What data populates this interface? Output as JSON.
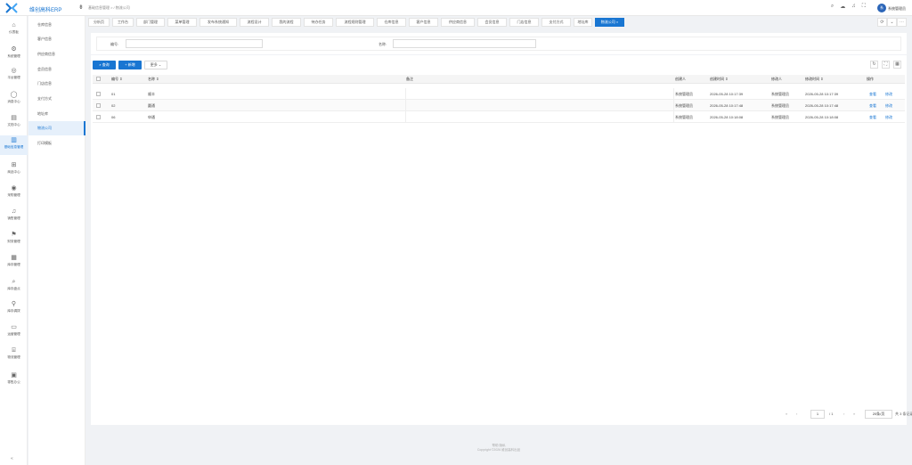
{
  "header": {
    "brand": "维创高科ERP",
    "breadcrumb": "基础信息管理 > / 物流公司",
    "username": "系统管理员",
    "avatar_text": "系",
    "icons": [
      "search-icon",
      "cloud-icon",
      "bell-icon",
      "fullscreen-icon"
    ]
  },
  "sidebar": {
    "items": [
      {
        "label": "仪表板",
        "icon": "home-icon"
      },
      {
        "label": "系统管理",
        "icon": "gear-icon"
      },
      {
        "label": "平台管理",
        "icon": "globe-icon"
      },
      {
        "label": "消息中心",
        "icon": "chat-icon"
      },
      {
        "label": "文档中心",
        "icon": "document-icon"
      },
      {
        "label": "基础信息管理",
        "icon": "book-icon"
      },
      {
        "label": "商品中心",
        "icon": "grid-icon"
      },
      {
        "label": "采购管理",
        "icon": "cart-icon"
      },
      {
        "label": "销售管理",
        "icon": "bell-icon"
      },
      {
        "label": "财务管理",
        "icon": "flag-icon"
      },
      {
        "label": "库存管理",
        "icon": "calendar-icon"
      },
      {
        "label": "库存盘点",
        "icon": "search-icon"
      },
      {
        "label": "库存调拨",
        "icon": "pin-icon"
      },
      {
        "label": "运营管理",
        "icon": "card-icon"
      },
      {
        "label": "物流管理",
        "icon": "box-icon"
      },
      {
        "label": "零售办公",
        "icon": "keyboard-icon"
      }
    ],
    "collapse_label": "«"
  },
  "submenu": {
    "items": [
      "仓库信息",
      "客户信息",
      "供应商信息",
      "会员信息",
      "门店信息",
      "支付方式",
      "地址库",
      "物流公司",
      "打印模板"
    ]
  },
  "tabs": {
    "items": [
      "分析页",
      "工作台",
      "部门管理",
      "菜单管理",
      "发布系统通知",
      "流程设计",
      "我的流程",
      "待办任务",
      "流程规则管理",
      "仓库信息",
      "客户信息",
      "供应商信息",
      "会员信息",
      "门店信息",
      "支付方式",
      "地址库",
      "物流公司"
    ],
    "tool_icons": [
      "⟳",
      "⌄",
      "⋯"
    ]
  },
  "search": {
    "code_label": "编号:",
    "name_label": "名称:",
    "code_value": "",
    "name_value": ""
  },
  "toolbar": {
    "query_label": "查询",
    "add_label": "+ 新增",
    "more_label": "更多 ⌄",
    "icons": [
      "refresh-icon",
      "fullscreen-icon",
      "columns-icon"
    ]
  },
  "table": {
    "columns": [
      "编号 ⇕",
      "名称 ⇕",
      "备注",
      "创建人",
      "创建时间 ⇕",
      "修改人",
      "修改时间 ⇕",
      "操作"
    ],
    "rows": [
      {
        "code": "01",
        "name": "顺丰",
        "remark": "",
        "creator": "系统管理员",
        "created": "2026-05-28 10:17:39",
        "modifier": "系统管理员",
        "modified": "2026-05-28 10:17:39"
      },
      {
        "code": "02",
        "name": "圆通",
        "remark": "",
        "creator": "系统管理员",
        "created": "2026-05-28 10:17:48",
        "modifier": "系统管理员",
        "modified": "2026-05-28 10:17:48"
      },
      {
        "code": "06",
        "name": "申通",
        "remark": "",
        "creator": "系统管理员",
        "created": "2026-05-28 10:18:08",
        "modifier": "系统管理员",
        "modified": "2026-05-28 10:18:08"
      }
    ],
    "view_label": "查看",
    "edit_label": "修改"
  },
  "pagination": {
    "current_page": "1",
    "total_pages": "/ 1",
    "page_size": "20条/页",
    "total": "共 3 条记录"
  },
  "footer": {
    "links": "帮助    隐私",
    "copyright": "Copyright ©2026 维创高科出品"
  },
  "colors": {
    "accent": "#1976d2"
  }
}
